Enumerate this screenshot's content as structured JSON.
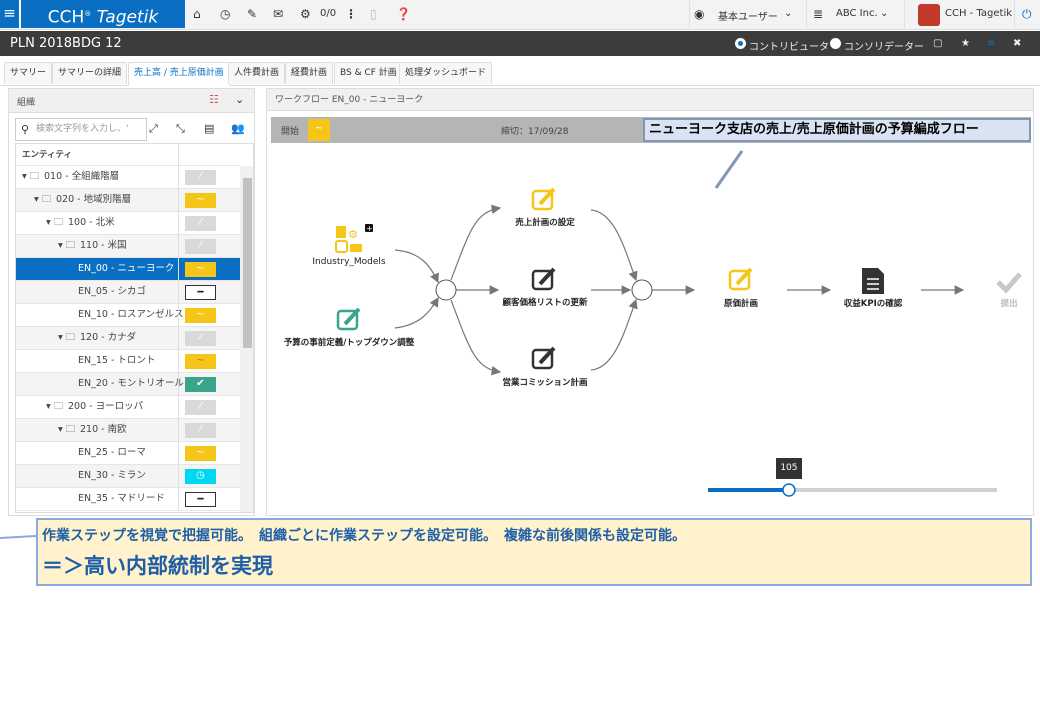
{
  "topbar": {
    "logo": "CCH",
    "logo_reg": "®",
    "logo_brand": "Tagetik",
    "tasks_count": "0/0",
    "user_role": "基本ユーザー",
    "company": "ABC Inc.",
    "user_name": "CCH - Tagetik",
    "icons": [
      "menu-icon",
      "home-icon",
      "clock-icon",
      "wrench-icon",
      "mail-icon",
      "gears-icon",
      "more-icon",
      "document-icon",
      "help-icon",
      "eye-icon",
      "database-icon",
      "power-icon"
    ]
  },
  "titlebar": {
    "title": "PLN 2018BDG 12",
    "radio_contributor": "コントリビュータ",
    "radio_consolidator": "コンソリデーター",
    "selected": "contributor"
  },
  "tabs": [
    {
      "label": "サマリー"
    },
    {
      "label": "サマリーの詳細"
    },
    {
      "label": "売上高 / 売上原価計画",
      "active": true
    },
    {
      "label": "人件費計画"
    },
    {
      "label": "経費計画"
    },
    {
      "label": "BS & CF 計画"
    },
    {
      "label": "処理ダッシュボード"
    }
  ],
  "left_panel": {
    "title": "組織",
    "search_placeholder": "検索文字列を入力し、'",
    "column_entity": "エンティティ",
    "rows": [
      {
        "label": "010 - 全組織階層",
        "folder": true,
        "status": "none"
      },
      {
        "label": "020 - 地域別階層",
        "folder": true,
        "status": "in-progress"
      },
      {
        "label": "100 - 北米",
        "folder": true,
        "status": "none"
      },
      {
        "label": "110 - 米国",
        "folder": true,
        "status": "none"
      },
      {
        "label": "EN_00 - ニューヨーク",
        "status": "in-progress",
        "selected": true
      },
      {
        "label": "EN_05 - シカゴ",
        "status": "not-started"
      },
      {
        "label": "EN_10 - ロスアンゼルス",
        "status": "in-progress"
      },
      {
        "label": "120 - カナダ",
        "folder": true,
        "status": "none"
      },
      {
        "label": "EN_15 - トロント",
        "status": "in-progress-red"
      },
      {
        "label": "EN_20 - モントリオール",
        "status": "done"
      },
      {
        "label": "200 - ヨーロッパ",
        "folder": true,
        "status": "none"
      },
      {
        "label": "210 - 南欧",
        "folder": true,
        "status": "none"
      },
      {
        "label": "EN_25 - ローマ",
        "status": "in-progress"
      },
      {
        "label": "EN_30 - ミラン",
        "status": "waiting"
      },
      {
        "label": "EN_35 - マドリード",
        "status": "not-started"
      }
    ]
  },
  "workflow": {
    "title": "ワークフロー EN_00 - ニューヨーク",
    "start_label": "開始",
    "deadline": "締切：17/09/28",
    "nodes": {
      "industry": "Industry_Models",
      "topdown": "予算の事前定義/トップダウン調整",
      "sales_plan": "売上計画の設定",
      "price_list": "顧客価格リストの更新",
      "commission": "営業コミッション計画",
      "cost_plan": "原価計画",
      "kpi": "収益KPIの確認",
      "submit": "提出"
    },
    "zoom": 105,
    "zoom_fraction": 0.28
  },
  "annotations": {
    "flow_title": "ニューヨーク支店の売上/売上原価計画の予算編成フロー",
    "line1": "作業ステップを視覚で把握可能。　組織ごとに作業ステップを設定可能。　複雑な前後関係も設定可能。",
    "line2": "＝＞高い内部統制を実現"
  },
  "colors": {
    "brand": "#0a6fc2",
    "in_progress": "#f5c518",
    "done": "#3aa58a",
    "waiting": "#00d7f0",
    "none": "#d9d9d9"
  }
}
